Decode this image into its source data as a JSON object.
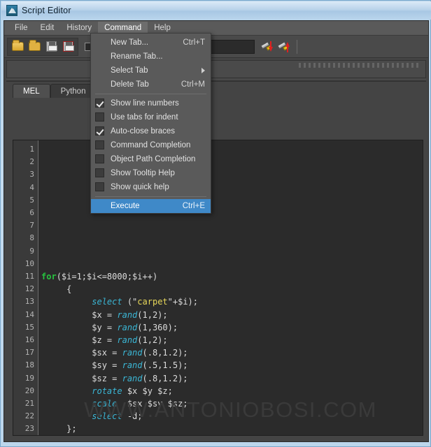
{
  "window": {
    "title": "Script Editor",
    "icon": "maya-app-icon"
  },
  "menubar": {
    "items": [
      {
        "label": "File",
        "active": false
      },
      {
        "label": "Edit",
        "active": false
      },
      {
        "label": "History",
        "active": false
      },
      {
        "label": "Command",
        "active": true
      },
      {
        "label": "Help",
        "active": false
      }
    ]
  },
  "toolbar": {
    "buttons": [
      {
        "name": "open-script-icon",
        "icon": "folder-open"
      },
      {
        "name": "load-script-icon",
        "icon": "doc-arrow"
      },
      {
        "name": "save-script-icon",
        "icon": "floppy-disk"
      },
      {
        "name": "save-script-as-icon",
        "icon": "floppy-disk-red"
      },
      {
        "name": "show-script-output-icon",
        "icon": "script-window"
      },
      {
        "name": "line-numbers-icon",
        "icon": "numbered-list"
      },
      {
        "name": "execute-all-icon",
        "icon": "double-arrow"
      },
      {
        "name": "execute-icon",
        "icon": "play-arrow"
      },
      {
        "name": "screw-down-icon",
        "icon": "screw-arrow-down"
      },
      {
        "name": "screw-up-icon",
        "icon": "screw-arrow-up"
      }
    ],
    "command_field_value": ""
  },
  "tabs": [
    {
      "label": "MEL",
      "selected": true
    },
    {
      "label": "Python",
      "selected": false
    }
  ],
  "command_menu": {
    "items": [
      {
        "type": "item",
        "label": "New Tab...",
        "accel": "Ctrl+T",
        "check": null,
        "submenu": false,
        "highlight": false
      },
      {
        "type": "item",
        "label": "Rename Tab...",
        "accel": "",
        "check": null,
        "submenu": false,
        "highlight": false
      },
      {
        "type": "item",
        "label": "Select Tab",
        "accel": "",
        "check": null,
        "submenu": true,
        "highlight": false
      },
      {
        "type": "item",
        "label": "Delete Tab",
        "accel": "Ctrl+M",
        "check": null,
        "submenu": false,
        "highlight": false
      },
      {
        "type": "sep"
      },
      {
        "type": "item",
        "label": "Show line numbers",
        "accel": "",
        "check": true,
        "submenu": false,
        "highlight": false
      },
      {
        "type": "item",
        "label": "Use tabs for indent",
        "accel": "",
        "check": false,
        "submenu": false,
        "highlight": false
      },
      {
        "type": "item",
        "label": "Auto-close braces",
        "accel": "",
        "check": true,
        "submenu": false,
        "highlight": false
      },
      {
        "type": "item",
        "label": "Command Completion",
        "accel": "",
        "check": false,
        "submenu": false,
        "highlight": false
      },
      {
        "type": "item",
        "label": "Object Path Completion",
        "accel": "",
        "check": false,
        "submenu": false,
        "highlight": false
      },
      {
        "type": "item",
        "label": "Show Tooltip Help",
        "accel": "",
        "check": false,
        "submenu": false,
        "highlight": false
      },
      {
        "type": "item",
        "label": "Show quick help",
        "accel": "",
        "check": false,
        "submenu": false,
        "highlight": false
      },
      {
        "type": "sep"
      },
      {
        "type": "item",
        "label": "Execute",
        "accel": "Ctrl+E",
        "check": null,
        "submenu": false,
        "highlight": true
      }
    ]
  },
  "editor": {
    "line_numbers": [
      1,
      2,
      3,
      4,
      5,
      6,
      7,
      8,
      9,
      10,
      11,
      12,
      13,
      14,
      15,
      16,
      17,
      18,
      19,
      20,
      21,
      22,
      23
    ],
    "lines": [
      {
        "n": 1,
        "tokens": []
      },
      {
        "n": 2,
        "tokens": []
      },
      {
        "n": 3,
        "tokens": []
      },
      {
        "n": 4,
        "tokens": []
      },
      {
        "n": 5,
        "tokens": []
      },
      {
        "n": 6,
        "tokens": []
      },
      {
        "n": 7,
        "tokens": []
      },
      {
        "n": 8,
        "tokens": []
      },
      {
        "n": 9,
        "tokens": []
      },
      {
        "n": 10,
        "tokens": []
      },
      {
        "n": 11,
        "tokens": [
          {
            "t": "kw",
            "v": "for"
          },
          {
            "t": "pl",
            "v": "($i=1;$i<=8000;$i++)"
          }
        ]
      },
      {
        "n": 12,
        "tokens": [
          {
            "t": "pl",
            "v": "     {"
          }
        ]
      },
      {
        "n": 13,
        "tokens": [
          {
            "t": "pl",
            "v": "          "
          },
          {
            "t": "cmd",
            "v": "select"
          },
          {
            "t": "pl",
            "v": " (\""
          },
          {
            "t": "str",
            "v": "carpet"
          },
          {
            "t": "pl",
            "v": "\"+$i);"
          }
        ]
      },
      {
        "n": 14,
        "tokens": [
          {
            "t": "pl",
            "v": "          $x = "
          },
          {
            "t": "fn",
            "v": "rand"
          },
          {
            "t": "pl",
            "v": "(1,2);"
          }
        ]
      },
      {
        "n": 15,
        "tokens": [
          {
            "t": "pl",
            "v": "          $y = "
          },
          {
            "t": "fn",
            "v": "rand"
          },
          {
            "t": "pl",
            "v": "(1,360);"
          }
        ]
      },
      {
        "n": 16,
        "tokens": [
          {
            "t": "pl",
            "v": "          $z = "
          },
          {
            "t": "fn",
            "v": "rand"
          },
          {
            "t": "pl",
            "v": "(1,2);"
          }
        ]
      },
      {
        "n": 17,
        "tokens": [
          {
            "t": "pl",
            "v": "          $sx = "
          },
          {
            "t": "fn",
            "v": "rand"
          },
          {
            "t": "pl",
            "v": "(.8,1.2);"
          }
        ]
      },
      {
        "n": 18,
        "tokens": [
          {
            "t": "pl",
            "v": "          $sy = "
          },
          {
            "t": "fn",
            "v": "rand"
          },
          {
            "t": "pl",
            "v": "(.5,1.5);"
          }
        ]
      },
      {
        "n": 19,
        "tokens": [
          {
            "t": "pl",
            "v": "          $sz = "
          },
          {
            "t": "fn",
            "v": "rand"
          },
          {
            "t": "pl",
            "v": "(.8,1.2);"
          }
        ]
      },
      {
        "n": 20,
        "tokens": [
          {
            "t": "pl",
            "v": "          "
          },
          {
            "t": "cmd",
            "v": "rotate"
          },
          {
            "t": "pl",
            "v": " $x $y $z;"
          }
        ]
      },
      {
        "n": 21,
        "tokens": [
          {
            "t": "pl",
            "v": "          "
          },
          {
            "t": "cmd",
            "v": "scale"
          },
          {
            "t": "pl",
            "v": "  $sx $sy $sz;"
          }
        ]
      },
      {
        "n": 22,
        "tokens": [
          {
            "t": "pl",
            "v": "          "
          },
          {
            "t": "cmd",
            "v": "select"
          },
          {
            "t": "pl",
            "v": " -d;"
          }
        ]
      },
      {
        "n": 23,
        "tokens": [
          {
            "t": "pl",
            "v": "     };"
          }
        ]
      }
    ],
    "watermark": "WWW.ANTONIOBOSI.COM"
  },
  "colors": {
    "titlebar_blue": "#b9d3ea",
    "panel_bg": "#444444",
    "menu_bg": "#5a5a5a",
    "editor_bg": "#2b2b2b",
    "gutter_bg": "#3a3a3a",
    "keyword_green": "#27c43f",
    "command_cyan": "#3bb7d6",
    "string_yellow": "#e8d85a",
    "highlight_blue": "#3f89c8",
    "watermark_gray": "#3a3a3a"
  }
}
